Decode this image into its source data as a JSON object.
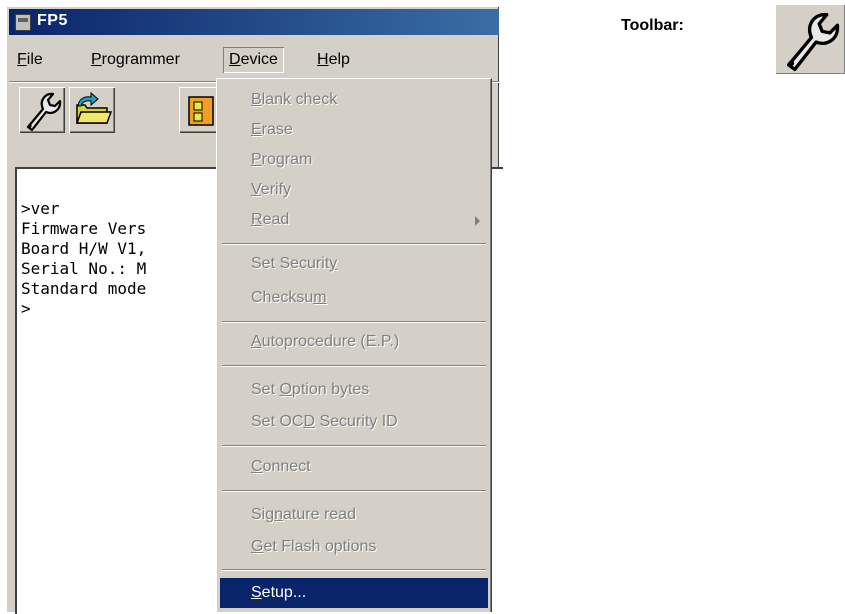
{
  "window": {
    "title": "FP5"
  },
  "menubar": [
    {
      "key": "file",
      "pre": "",
      "u": "F",
      "post": "ile"
    },
    {
      "key": "programmer",
      "pre": "",
      "u": "P",
      "post": "rogrammer"
    },
    {
      "key": "device",
      "pre": "",
      "u": "D",
      "post": "evice"
    },
    {
      "key": "help",
      "pre": "",
      "u": "H",
      "post": "elp"
    }
  ],
  "toolbar_buttons": [
    "setup-wrench-icon",
    "open-folder-icon",
    "device-chip-icon"
  ],
  "console": {
    "lines": [
      ">ver",
      "Firmware Vers",
      "Board H/W V1,",
      "Serial No.: M",
      "Standard mode",
      ">"
    ]
  },
  "device_menu": {
    "items": [
      {
        "pre": "",
        "u": "B",
        "post": "lank check",
        "enabled": false
      },
      {
        "pre": "",
        "u": "E",
        "post": "rase",
        "enabled": false
      },
      {
        "pre": "",
        "u": "P",
        "post": "rogram",
        "enabled": false
      },
      {
        "pre": "",
        "u": "V",
        "post": "erify",
        "enabled": false
      },
      {
        "pre": "",
        "u": "R",
        "post": "ead",
        "enabled": false,
        "submenu": true
      },
      {
        "pre": "Set Securit",
        "u": "y",
        "post": "",
        "enabled": false
      },
      {
        "pre": "Checksu",
        "u": "m",
        "post": "",
        "enabled": false
      },
      {
        "pre": "",
        "u": "A",
        "post": "utoprocedure (E.P.)",
        "enabled": false
      },
      {
        "pre": "Set ",
        "u": "O",
        "post": "ption bytes",
        "enabled": false
      },
      {
        "pre": "Set OC",
        "u": "D",
        "post": " Security ID",
        "enabled": false
      },
      {
        "pre": "",
        "u": "C",
        "post": "onnect",
        "enabled": false
      },
      {
        "pre": "Sig",
        "u": "n",
        "post": "ature read",
        "enabled": false
      },
      {
        "pre": "",
        "u": "G",
        "post": "et Flash options",
        "enabled": false
      },
      {
        "pre": "",
        "u": "S",
        "post": "etup...",
        "enabled": true,
        "selected": true
      }
    ]
  },
  "side": {
    "toolbar_label": "Toolbar:",
    "icon": "setup-wrench-icon"
  },
  "colors": {
    "title_bar": "#0a246a",
    "selection": "#0a246a",
    "face": "#d4d0c8",
    "disabled_text": "#808080"
  }
}
